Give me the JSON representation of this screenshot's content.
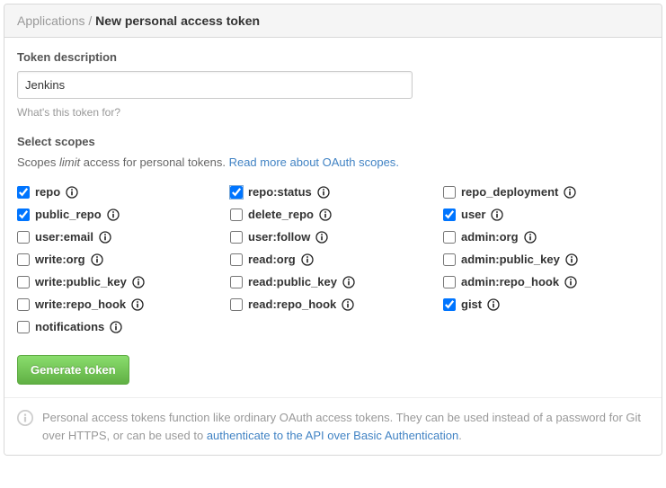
{
  "header": {
    "breadcrumb_root": "Applications",
    "breadcrumb_sep": " / ",
    "breadcrumb_current": "New personal access token"
  },
  "description": {
    "label": "Token description",
    "value": "Jenkins",
    "hint": "What's this token for?"
  },
  "scopes": {
    "label": "Select scopes",
    "desc_pre": "Scopes ",
    "desc_em": "limit",
    "desc_post": " access for personal tokens. ",
    "link_text": "Read more about OAuth scopes",
    "items": [
      {
        "name": "repo",
        "checked": true
      },
      {
        "name": "public_repo",
        "checked": true
      },
      {
        "name": "user:email",
        "checked": false
      },
      {
        "name": "write:org",
        "checked": false
      },
      {
        "name": "write:public_key",
        "checked": false
      },
      {
        "name": "write:repo_hook",
        "checked": false
      },
      {
        "name": "notifications",
        "checked": false
      },
      {
        "name": "repo:status",
        "checked": true,
        "highlight": true
      },
      {
        "name": "delete_repo",
        "checked": false
      },
      {
        "name": "user:follow",
        "checked": false
      },
      {
        "name": "read:org",
        "checked": false
      },
      {
        "name": "read:public_key",
        "checked": false
      },
      {
        "name": "read:repo_hook",
        "checked": false
      },
      {
        "name": "repo_deployment",
        "checked": false
      },
      {
        "name": "user",
        "checked": true
      },
      {
        "name": "admin:org",
        "checked": false
      },
      {
        "name": "admin:public_key",
        "checked": false
      },
      {
        "name": "admin:repo_hook",
        "checked": false
      },
      {
        "name": "gist",
        "checked": true
      }
    ]
  },
  "colors": {
    "primary_button_bg": "#60b044",
    "link_color": "#4183c4"
  },
  "actions": {
    "generate_label": "Generate token"
  },
  "footer": {
    "text_pre": "Personal access tokens function like ordinary OAuth access tokens. They can be used instead of a password for Git over HTTPS, or can be used to ",
    "link_text": "authenticate to the API over Basic Authentication",
    "text_post": "."
  }
}
